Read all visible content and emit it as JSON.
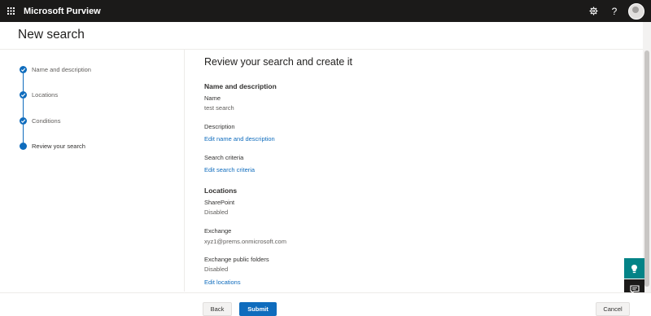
{
  "app": {
    "title": "Microsoft Purview",
    "help_label": "?"
  },
  "page": {
    "title": "New search"
  },
  "steps": [
    {
      "label": "Name and description",
      "state": "completed"
    },
    {
      "label": "Locations",
      "state": "completed"
    },
    {
      "label": "Conditions",
      "state": "completed"
    },
    {
      "label": "Review your search",
      "state": "current"
    }
  ],
  "review": {
    "title": "Review your search and create it",
    "name_section": {
      "heading": "Name and description",
      "name_label": "Name",
      "name_value": "test search",
      "description_label": "Description",
      "edit_link": "Edit name and description"
    },
    "criteria": {
      "label": "Search criteria",
      "edit_link": "Edit search criteria"
    },
    "locations": {
      "heading": "Locations",
      "sharepoint_label": "SharePoint",
      "sharepoint_value": "Disabled",
      "exchange_label": "Exchange",
      "exchange_value": "xyz1@prems.onmicrosoft.com",
      "public_folders_label": "Exchange public folders",
      "public_folders_value": "Disabled",
      "edit_link": "Edit locations"
    }
  },
  "footer": {
    "back_label": "Back",
    "submit_label": "Submit",
    "cancel_label": "Cancel"
  },
  "colors": {
    "topbar": "#1b1a19",
    "accent": "#0f6cbd",
    "feedback": "#038387"
  }
}
